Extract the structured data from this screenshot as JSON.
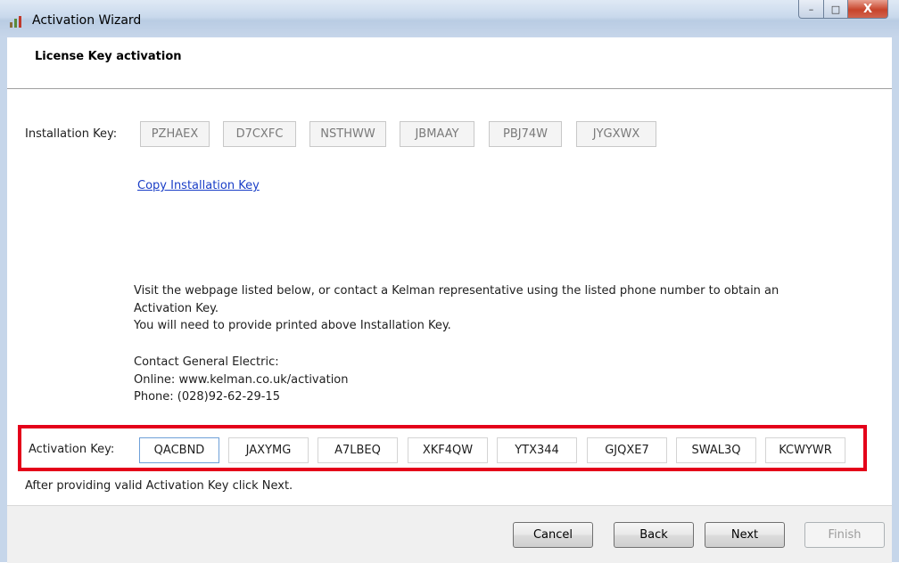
{
  "window": {
    "title": "Activation Wizard",
    "caption": {
      "minimize": "–",
      "maximize": "□",
      "close": "X"
    }
  },
  "header": {
    "title": "License Key activation"
  },
  "installation": {
    "label": "Installation Key:",
    "keys": [
      "PZHAEX",
      "D7CXFC",
      "NSTHWW",
      "JBMAAY",
      "PBJ74W",
      "JYGXWX"
    ],
    "copy_link": "Copy Installation Key"
  },
  "info": {
    "line1": "Visit the webpage listed below, or contact a Kelman representative using the listed phone number to obtain an",
    "line2": "Activation Key.",
    "line3": "You will need to provide printed above Installation Key.",
    "contact_heading": "Contact General Electric:",
    "online": "Online: www.kelman.co.uk/activation",
    "phone": "Phone: (028)92-62-29-15"
  },
  "activation": {
    "label": "Activation Key:",
    "keys": [
      "QACBND",
      "JAXYMG",
      "A7LBEQ",
      "XKF4QW",
      "YTX344",
      "GJQXE7",
      "SWAL3Q",
      "KCWYWR"
    ],
    "hint": "After providing valid Activation Key click Next."
  },
  "buttons": {
    "cancel": "Cancel",
    "back": "Back",
    "next": "Next",
    "finish": "Finish"
  },
  "colors": {
    "highlight": "#e4001a",
    "link": "#1a3ec7"
  }
}
